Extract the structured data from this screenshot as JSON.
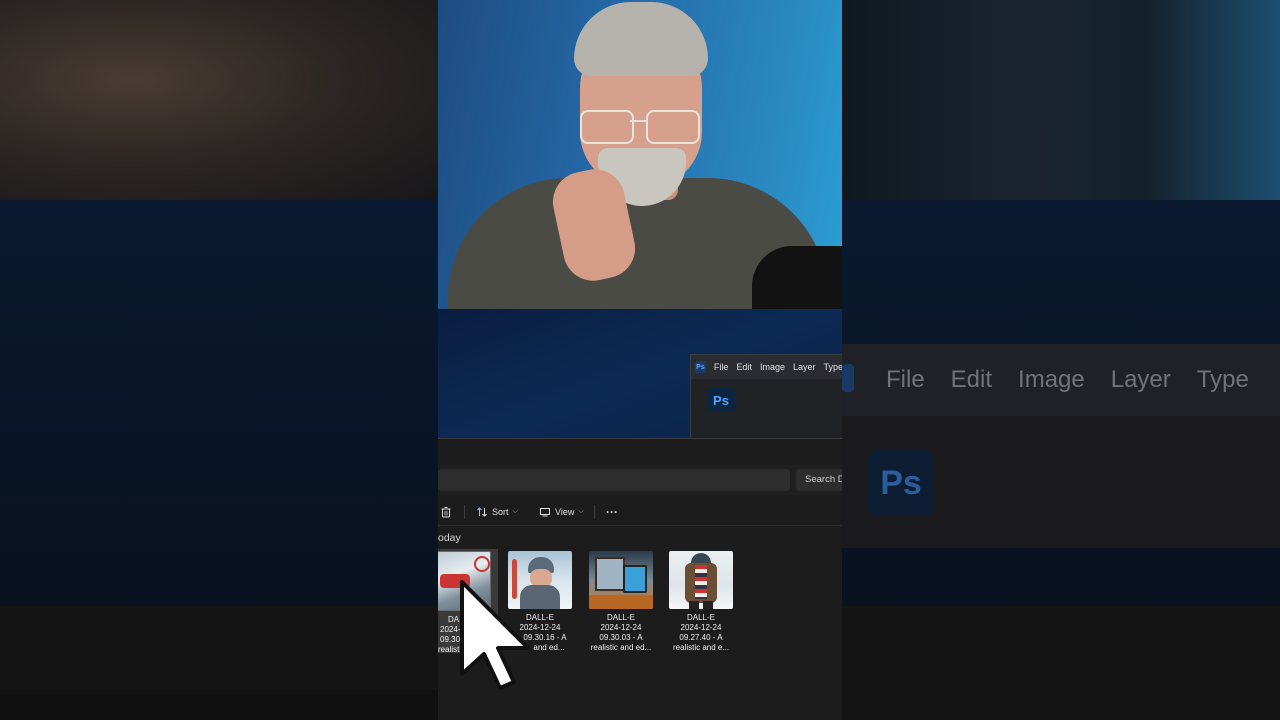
{
  "photoshop": {
    "app_badge": "Ps",
    "logo": "Ps",
    "menu": [
      "File",
      "Edit",
      "Image",
      "Layer",
      "Type"
    ]
  },
  "explorer": {
    "search_placeholder": "Search D",
    "toolbar": {
      "sort_label": "Sort",
      "view_label": "View",
      "more_label": "···"
    },
    "group_header": "oday",
    "files": [
      {
        "line1": "DA",
        "line2": "2024-",
        "line3": "09.30",
        "line4": "realistic"
      },
      {
        "line1": "DALL-E",
        "line2": "2024-12-24",
        "line3": "09.30.16 - A",
        "line4": "and ed..."
      },
      {
        "line1": "DALL-E",
        "line2": "2024-12-24",
        "line3": "09.30.03 - A",
        "line4": "realistic and ed..."
      },
      {
        "line1": "DALL-E",
        "line2": "2024-12-24",
        "line3": "09.27.40 - A",
        "line4": "realistic and e..."
      }
    ]
  },
  "icons": {
    "delete": "trash-icon",
    "sort": "sort-icon",
    "view": "view-icon",
    "cursor": "mouse-pointer-icon"
  }
}
